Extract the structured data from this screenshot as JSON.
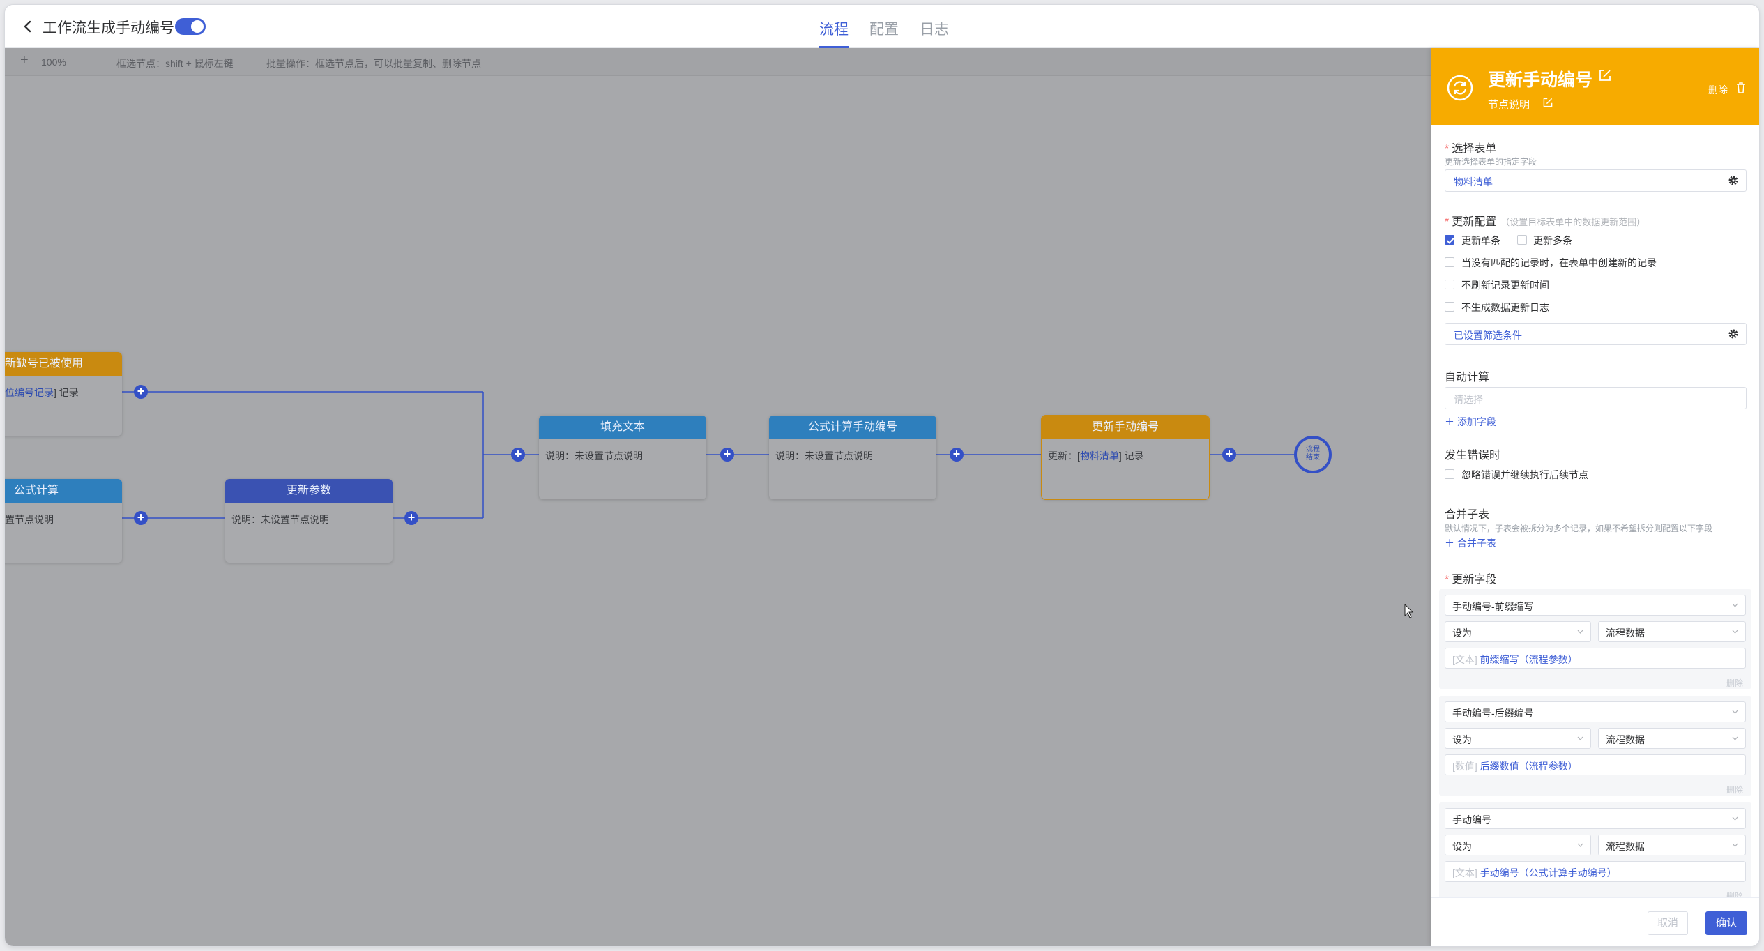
{
  "header": {
    "title": "工作流生成手动编号",
    "enabled": true,
    "tabs": [
      {
        "label": "流程",
        "active": true
      },
      {
        "label": "配置",
        "active": false
      },
      {
        "label": "日志",
        "active": false
      }
    ]
  },
  "toolbar": {
    "zoom_in": "+",
    "zoom": "100%",
    "zoom_out": "—",
    "select_hint": "框选节点：shift + 鼠标左键",
    "batch_hint": "批量操作：框选节点后，可以批量复制、删除节点"
  },
  "flow": {
    "nodes": [
      {
        "title": "新缺号已被使用",
        "desc_pre": "",
        "desc_link": "位编号记录",
        "desc_post": "] 记录"
      },
      {
        "title": "公式计算",
        "desc": "置节点说明"
      },
      {
        "title": "更新参数",
        "desc": "说明：未设置节点说明"
      },
      {
        "title": "填充文本",
        "desc": "说明：未设置节点说明"
      },
      {
        "title": "公式计算手动编号",
        "desc": "说明：未设置节点说明"
      },
      {
        "title": "更新手动编号",
        "desc_pre": "更新：[",
        "desc_link": "物料清单",
        "desc_post": "] 记录"
      }
    ],
    "end_label_1": "流程",
    "end_label_2": "结束"
  },
  "drawer": {
    "title": "更新手动编号",
    "subtitle": "节点说明",
    "delete_label": "删除",
    "form_section": {
      "label": "选择表单",
      "hint": "更新选择表单的指定字段",
      "value": "物料清单"
    },
    "config_section": {
      "label": "更新配置",
      "hint": "（设置目标表单中的数据更新范围）",
      "update_single": "更新单条",
      "update_multiple": "更新多条",
      "create_if_none": "当没有匹配的记录时，在表单中创建新的记录",
      "no_refresh_time": "不刷新记录更新时间",
      "no_log": "不生成数据更新日志",
      "filter": "已设置筛选条件"
    },
    "auto_calc": {
      "label": "自动计算",
      "placeholder": "请选择",
      "add_field": "添加字段"
    },
    "on_error": {
      "label": "发生错误时",
      "option": "忽略错误并继续执行后续节点"
    },
    "merge": {
      "label": "合并子表",
      "hint": "默认情况下，子表会被拆分为多个记录，如果不希望拆分则配置以下字段",
      "add": "合并子表"
    },
    "update_fields": {
      "label": "更新字段",
      "items": [
        {
          "field": "手动编号-前缀缩写",
          "op": "设为",
          "source": "流程数据",
          "value_type": "[文本]",
          "value": "前缀缩写（流程参数）",
          "delete": "删除"
        },
        {
          "field": "手动编号-后缀编号",
          "op": "设为",
          "source": "流程数据",
          "value_type": "[数值]",
          "value": "后缀数值（流程参数）",
          "delete": "删除"
        },
        {
          "field": "手动编号",
          "op": "设为",
          "source": "流程数据",
          "value_type": "[文本]",
          "value": "手动编号（公式计算手动编号）",
          "delete": "删除"
        }
      ]
    },
    "cancel": "取消",
    "confirm": "确认"
  }
}
